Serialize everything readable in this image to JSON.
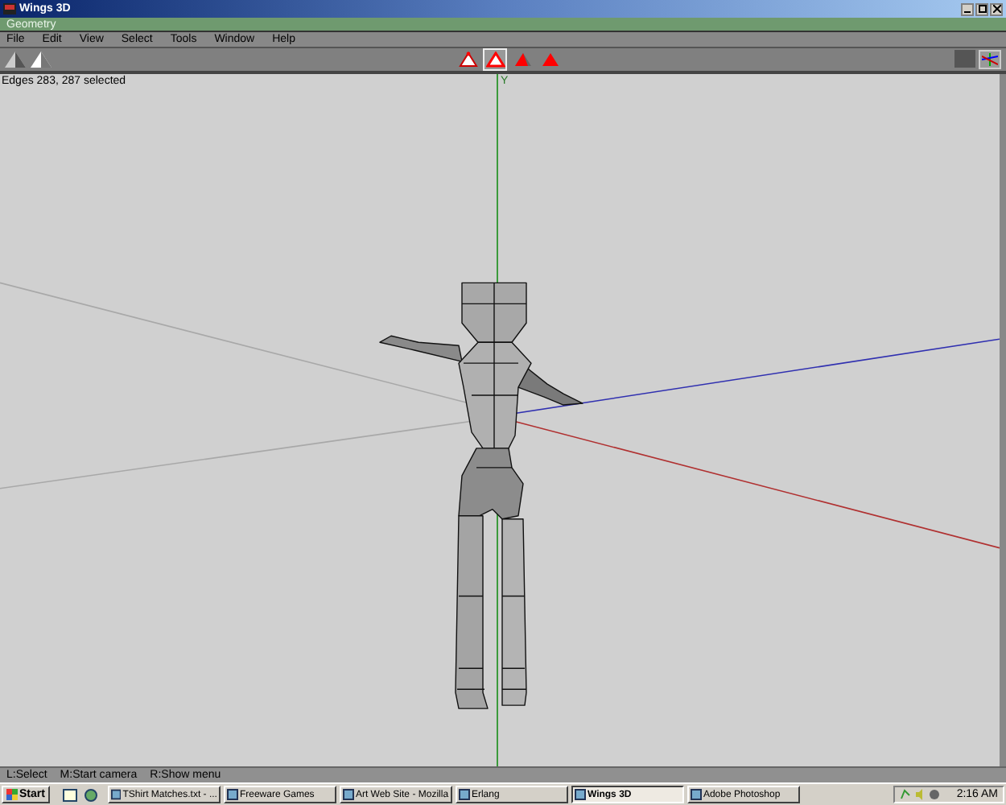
{
  "window": {
    "title": "Wings 3D"
  },
  "mode_bar": {
    "title": "Geometry"
  },
  "menu": [
    "File",
    "Edit",
    "View",
    "Select",
    "Tools",
    "Window",
    "Help"
  ],
  "select_modes": [
    {
      "kind": "vertex",
      "selected": false
    },
    {
      "kind": "edge",
      "selected": true
    },
    {
      "kind": "face",
      "selected": false
    },
    {
      "kind": "body",
      "selected": false
    }
  ],
  "viewport": {
    "info": "Edges 283, 287 selected",
    "axis_label": "Y"
  },
  "hint_bar": [
    "L:Select",
    "M:Start camera",
    "R:Show menu"
  ],
  "taskbar": {
    "start": "Start",
    "tasks": [
      {
        "label": "TShirt Matches.txt - ...",
        "selected": false
      },
      {
        "label": "Freeware Games",
        "selected": false
      },
      {
        "label": "Art Web Site - Mozilla",
        "selected": false
      },
      {
        "label": "Erlang",
        "selected": false
      },
      {
        "label": "Wings 3D",
        "selected": true
      },
      {
        "label": "Adobe Photoshop",
        "selected": false
      }
    ],
    "clock": "2:16 AM"
  }
}
